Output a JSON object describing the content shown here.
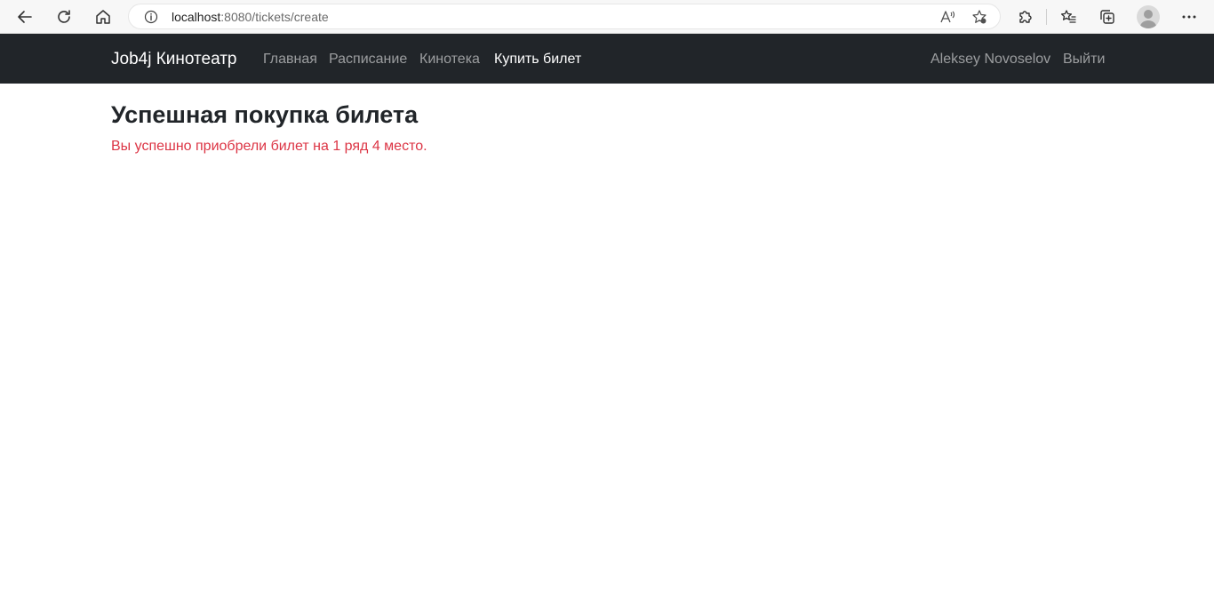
{
  "browser": {
    "url_host": "localhost",
    "url_path": ":8080/tickets/create"
  },
  "navbar": {
    "brand": "Job4j Кинотеатр",
    "links": [
      {
        "label": "Главная",
        "active": false
      },
      {
        "label": "Расписание",
        "active": false
      },
      {
        "label": "Кинотека",
        "active": false
      },
      {
        "label": "Купить билет",
        "active": true
      }
    ],
    "user_name": "Aleksey Novoselov",
    "logout_label": "Выйти"
  },
  "main": {
    "title": "Успешная покупка билета",
    "message": "Вы успешно приобрели билет на 1 ряд 4 место."
  },
  "colors": {
    "navbar_bg": "#212529",
    "message_color": "#dc3545"
  }
}
